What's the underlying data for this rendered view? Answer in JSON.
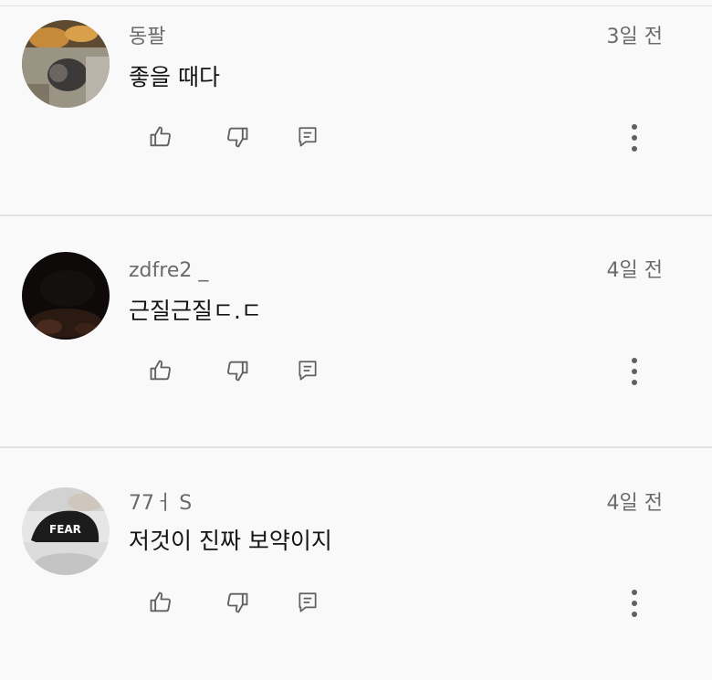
{
  "comments": [
    {
      "author": "동팔",
      "time": "3일 전",
      "text": "좋을 때다",
      "avatar_icon": "user-photo-avatar"
    },
    {
      "author": "zdfre2 _",
      "time": "4일 전",
      "text": "근질근질ㄷ.ㄷ",
      "avatar_icon": "user-photo-avatar"
    },
    {
      "author": "77ㅓ S",
      "time": "4일 전",
      "text": "저것이 진짜 보약이지",
      "avatar_icon": "user-photo-avatar"
    }
  ],
  "action_icons": [
    "thumbs-up-icon",
    "thumbs-down-icon",
    "reply-icon",
    "more-vert-icon"
  ],
  "colors": {
    "background": "#f9f9f9",
    "divider": "#e2e2e2",
    "meta_text": "#6b6b6b",
    "body_text": "#151515",
    "icon": "#606060"
  }
}
